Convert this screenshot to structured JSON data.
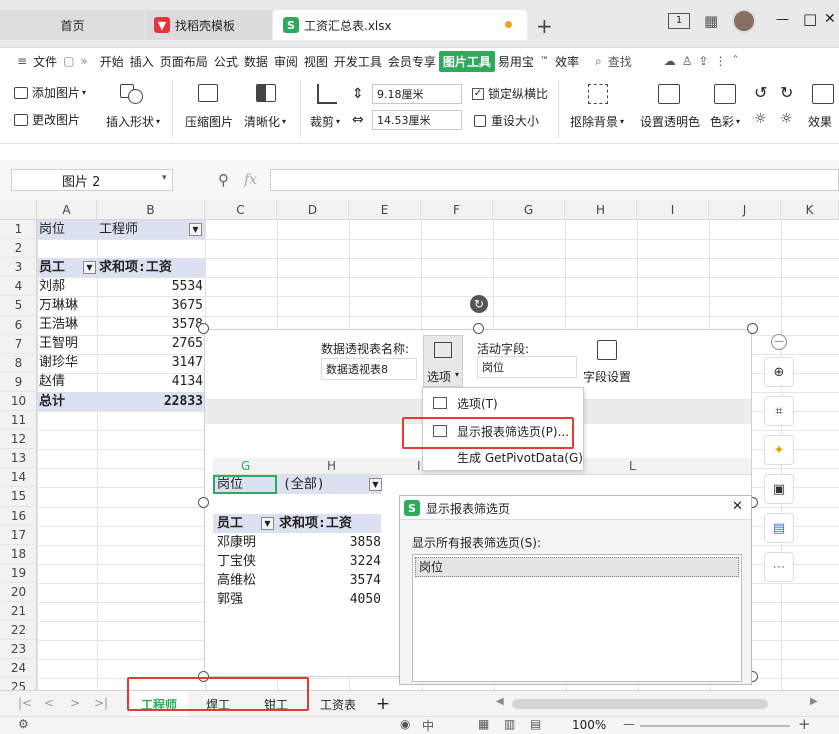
{
  "tabs": {
    "home": "首页",
    "template": "找稻壳模板",
    "file": "工资汇总表.xlsx",
    "add": "+"
  },
  "window": {
    "badge": "1",
    "minimize": "—",
    "maximize": "□",
    "close": "✕"
  },
  "menu": {
    "file": "文件",
    "items": [
      "开始",
      "插入",
      "页面布局",
      "公式",
      "数据",
      "审阅",
      "视图",
      "开发工具",
      "会员专享"
    ],
    "active": "图片工具",
    "items2": [
      "易用宝",
      "™",
      "效率"
    ],
    "search": "查找"
  },
  "ribbon": {
    "add_picture": "添加图片",
    "change_picture": "更改图片",
    "insert_shape": "插入形状",
    "compress": "压缩图片",
    "sharpen": "清晰化",
    "crop": "裁剪",
    "height": "9.18厘米",
    "width": "14.53厘米",
    "lock_ratio": "锁定纵横比",
    "reset_size": "重设大小",
    "remove_bg": "抠除背景",
    "set_transparent": "设置透明色",
    "color": "色彩",
    "effect": "效果"
  },
  "formula": {
    "namebox": "图片 2",
    "fx": "fx"
  },
  "columns": [
    "A",
    "B",
    "C",
    "D",
    "E",
    "F",
    "G",
    "H",
    "I",
    "J",
    "K"
  ],
  "rows": [
    "1",
    "2",
    "3",
    "4",
    "5",
    "6",
    "7",
    "8",
    "9",
    "10",
    "11",
    "12",
    "13",
    "14",
    "15",
    "16",
    "17",
    "18",
    "19",
    "20",
    "21",
    "22",
    "23",
    "24",
    "25"
  ],
  "pivot1": {
    "filter_field": "岗位",
    "filter_value": "工程师",
    "row_label": "员工",
    "value_label": "求和项:工资",
    "rows": [
      {
        "name": "刘郝",
        "value": "5534"
      },
      {
        "name": "万琳琳",
        "value": "3675"
      },
      {
        "name": "王浩琳",
        "value": "3578"
      },
      {
        "name": "王智明",
        "value": "2765"
      },
      {
        "name": "谢珍华",
        "value": "3147"
      },
      {
        "name": "赵倩",
        "value": "4134"
      }
    ],
    "total_label": "总计",
    "total_value": "22833"
  },
  "pic_toolbar": {
    "name_label": "数据透视表名称:",
    "name_value": "数据透视表8",
    "options": "选项",
    "active_label": "活动字段:",
    "active_value": "岗位",
    "field_settings": "字段设置"
  },
  "popup": {
    "item1": "选项(T)",
    "item2": "显示报表筛选页(P)...",
    "item3": "生成 GetPivotData(G)"
  },
  "inner_cols": [
    "G",
    "H",
    "I",
    "L"
  ],
  "pivot2": {
    "filter_field": "岗位",
    "filter_value": "(全部)",
    "row_label": "员工",
    "value_label": "求和项:工资",
    "rows": [
      {
        "name": "邓康明",
        "value": "3858"
      },
      {
        "name": "丁宝侠",
        "value": "3224"
      },
      {
        "name": "高维松",
        "value": "3574"
      },
      {
        "name": "郭强",
        "value": "4050"
      }
    ]
  },
  "dialog": {
    "title": "显示报表筛选页",
    "label": "显示所有报表筛选页(S):",
    "item": "岗位",
    "close": "✕"
  },
  "sheets": {
    "s1": "工程师",
    "s2": "焊工",
    "s3": "钳工",
    "s4": "工资表",
    "add": "+"
  },
  "status": {
    "zoom": "100%",
    "minus": "—",
    "plus": "+"
  },
  "colors": {
    "accent": "#2eaa5c",
    "highlight": "#e53935",
    "pivot_header": "#dbe1f1"
  }
}
